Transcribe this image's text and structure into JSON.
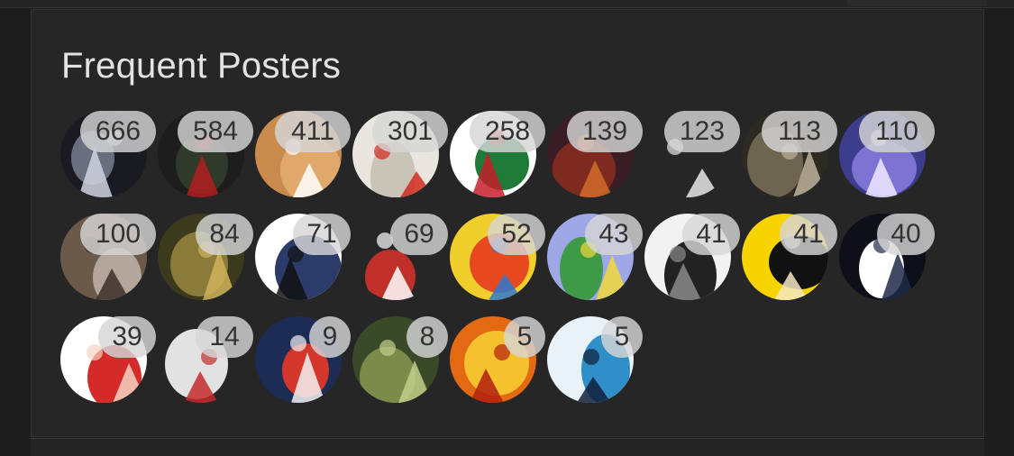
{
  "widget": {
    "title": "Frequent Posters"
  },
  "posters": [
    {
      "count": "666",
      "palette": [
        "#1a1b22",
        "#6a6f80",
        "#cfd3de"
      ]
    },
    {
      "count": "584",
      "palette": [
        "#1d1d1d",
        "#2f3a2a",
        "#b01e1e"
      ]
    },
    {
      "count": "411",
      "palette": [
        "#c98a4e",
        "#e0a86a",
        "#ffffff"
      ]
    },
    {
      "count": "301",
      "palette": [
        "#e9e6df",
        "#c9c4b8",
        "#d22a1f"
      ]
    },
    {
      "count": "258",
      "palette": [
        "#ffffff",
        "#1f7a37",
        "#c61f2c"
      ]
    },
    {
      "count": "139",
      "palette": [
        "#3a1d24",
        "#7d2a20",
        "#d26b2b"
      ]
    },
    {
      "count": "123",
      "palette": [
        "#262626",
        "#262626",
        "#e8e8e8"
      ]
    },
    {
      "count": "113",
      "palette": [
        "#2d2a22",
        "#6e6452",
        "#bdb29a"
      ]
    },
    {
      "count": "110",
      "palette": [
        "#3c3d8c",
        "#7d73d3",
        "#efe9ff"
      ]
    },
    {
      "count": "100",
      "palette": [
        "#6b5a4a",
        "#b3a79b",
        "#3c2f2a"
      ]
    },
    {
      "count": "84",
      "palette": [
        "#3b3a1d",
        "#8a7b3a",
        "#d0b35a"
      ]
    },
    {
      "count": "71",
      "palette": [
        "#ffffff",
        "#2b3c6a",
        "#111111"
      ]
    },
    {
      "count": "69",
      "palette": [
        "#262626",
        "#c0302a",
        "#ffffff"
      ]
    },
    {
      "count": "52",
      "palette": [
        "#f1cf2a",
        "#e6491f",
        "#2c7ad1"
      ]
    },
    {
      "count": "43",
      "palette": [
        "#9fa8e6",
        "#3e9a46",
        "#f1d93a"
      ]
    },
    {
      "count": "41",
      "palette": [
        "#f2f2f2",
        "#222222",
        "#8a8a8a"
      ]
    },
    {
      "count": "41",
      "palette": [
        "#f7d400",
        "#111111",
        "#f3e7c2"
      ]
    },
    {
      "count": "40",
      "palette": [
        "#0e0f18",
        "#ffffff",
        "#1f2a48"
      ]
    },
    {
      "count": "39",
      "palette": [
        "#ffffff",
        "#d42a2a",
        "#f3d4c2"
      ]
    },
    {
      "count": "14",
      "palette": [
        "#262626",
        "#e2e2e2",
        "#c42b2b"
      ]
    },
    {
      "count": "9",
      "palette": [
        "#1d2c54",
        "#d3362a",
        "#f2f2f2"
      ]
    },
    {
      "count": "8",
      "palette": [
        "#3a4a28",
        "#7b8c4a",
        "#c3cf8a"
      ]
    },
    {
      "count": "5",
      "palette": [
        "#e36a12",
        "#f6c12e",
        "#b31e0f"
      ]
    },
    {
      "count": "5",
      "palette": [
        "#e8f2f8",
        "#2f8fc8",
        "#0f1f3a"
      ]
    }
  ]
}
